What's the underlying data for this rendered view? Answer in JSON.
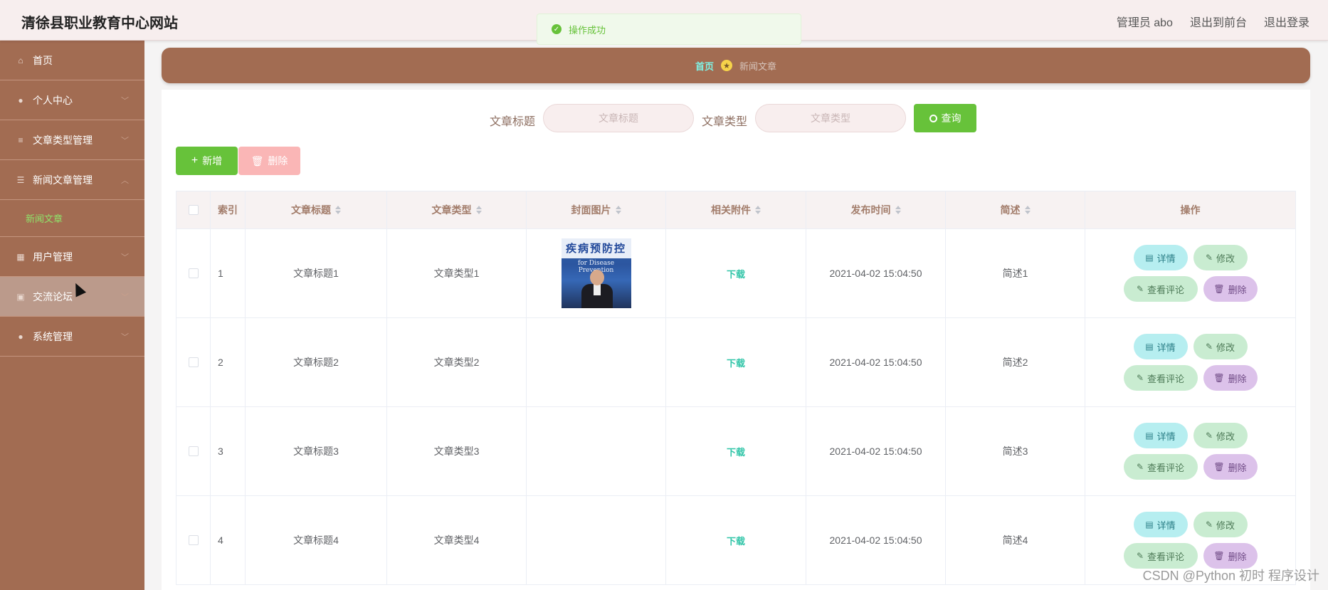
{
  "header": {
    "site_title": "清徐县职业教育中心网站",
    "admin_label": "管理员 abo",
    "to_front_label": "退出到前台",
    "logout_label": "退出登录"
  },
  "toast": {
    "message": "操作成功"
  },
  "sidebar": {
    "items": [
      {
        "label": "首页",
        "icon": "home-icon"
      },
      {
        "label": "个人中心",
        "icon": "user-icon"
      },
      {
        "label": "文章类型管理",
        "icon": "list-icon"
      },
      {
        "label": "新闻文章管理",
        "icon": "sliders-icon"
      },
      {
        "label": "新闻文章",
        "icon": "",
        "sub": true
      },
      {
        "label": "用户管理",
        "icon": "building-icon"
      },
      {
        "label": "交流论坛",
        "icon": "clipboard-icon"
      },
      {
        "label": "系统管理",
        "icon": "user-icon"
      }
    ]
  },
  "breadcrumb": {
    "home": "首页",
    "current": "新闻文章"
  },
  "search": {
    "title_label": "文章标题",
    "title_placeholder": "文章标题",
    "type_label": "文章类型",
    "type_placeholder": "文章类型",
    "query_label": "查询"
  },
  "toolbar": {
    "add_label": "新增",
    "delete_label": "删除"
  },
  "table": {
    "columns": [
      "索引",
      "文章标题",
      "文章类型",
      "封面图片",
      "相关附件",
      "发布时间",
      "简述",
      "操作"
    ],
    "rows": [
      {
        "index": "1",
        "title": "文章标题1",
        "type": "文章类型1",
        "has_cover": true,
        "attachment": "下载",
        "time": "2021-04-02 15:04:50",
        "summary": "简述1"
      },
      {
        "index": "2",
        "title": "文章标题2",
        "type": "文章类型2",
        "has_cover": false,
        "attachment": "下载",
        "time": "2021-04-02 15:04:50",
        "summary": "简述2"
      },
      {
        "index": "3",
        "title": "文章标题3",
        "type": "文章类型3",
        "has_cover": false,
        "attachment": "下载",
        "time": "2021-04-02 15:04:50",
        "summary": "简述3"
      },
      {
        "index": "4",
        "title": "文章标题4",
        "type": "文章类型4",
        "has_cover": false,
        "attachment": "下载",
        "time": "2021-04-02 15:04:50",
        "summary": "简述4"
      }
    ],
    "actions": {
      "detail": "详情",
      "edit": "修改",
      "comment": "查看评论",
      "delete": "删除"
    },
    "cover_text": {
      "top": "疾病预防控",
      "sub": "for Disease Prevention"
    }
  },
  "watermark": "CSDN @Python 初时 程序设计",
  "colors": {
    "sidebar": "#a26c52",
    "accent_green": "#67c23a",
    "sub_active": "#8fe36a"
  }
}
